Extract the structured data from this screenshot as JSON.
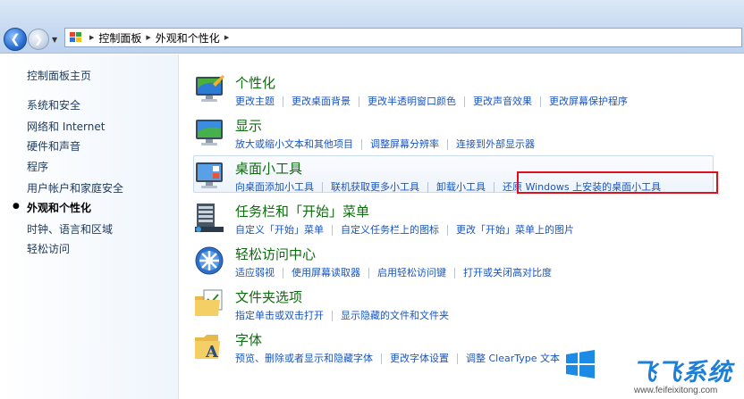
{
  "colors": {
    "link": "#1a55c0",
    "category_title": "#0e6b0e",
    "highlight_box": "#e0101a",
    "watermark": "#1c7fd8"
  },
  "breadcrumb": [
    "控制面板",
    "外观和个性化"
  ],
  "sidebar": {
    "home": "控制面板主页",
    "items": [
      {
        "label": "系统和安全"
      },
      {
        "label": "网络和 Internet"
      },
      {
        "label": "硬件和声音"
      },
      {
        "label": "程序"
      },
      {
        "label": "用户帐户和家庭安全"
      },
      {
        "label": "外观和个性化",
        "active": true
      },
      {
        "label": "时钟、语言和区域"
      },
      {
        "label": "轻松访问"
      }
    ]
  },
  "categories": [
    {
      "title": "个性化",
      "icon": "personalization-icon",
      "links": [
        "更改主题",
        "更改桌面背景",
        "更改半透明窗口颜色",
        "更改声音效果",
        "更改屏幕保护程序"
      ]
    },
    {
      "title": "显示",
      "icon": "display-icon",
      "links": [
        "放大或缩小文本和其他项目",
        "调整屏幕分辨率",
        "连接到外部显示器"
      ]
    },
    {
      "title": "桌面小工具",
      "icon": "gadgets-icon",
      "links": [
        "向桌面添加小工具",
        "联机获取更多小工具",
        "卸载小工具",
        "还原 Windows 上安装的桌面小工具"
      ]
    },
    {
      "title": "任务栏和「开始」菜单",
      "icon": "taskbar-icon",
      "links": [
        "自定义「开始」菜单",
        "自定义任务栏上的图标",
        "更改「开始」菜单上的图片"
      ]
    },
    {
      "title": "轻松访问中心",
      "icon": "ease-of-access-icon",
      "links": [
        "适应弱视",
        "使用屏幕读取器",
        "启用轻松访问键",
        "打开或关闭高对比度"
      ]
    },
    {
      "title": "文件夹选项",
      "icon": "folder-options-icon",
      "links": [
        "指定单击或双击打开",
        "显示隐藏的文件和文件夹"
      ]
    },
    {
      "title": "字体",
      "icon": "fonts-icon",
      "links": [
        "预览、删除或者显示和隐藏字体",
        "更改字体设置",
        "调整 ClearType 文本"
      ]
    }
  ],
  "watermark": {
    "text": "飞飞系统",
    "url": "www.feifeixitong.com"
  }
}
